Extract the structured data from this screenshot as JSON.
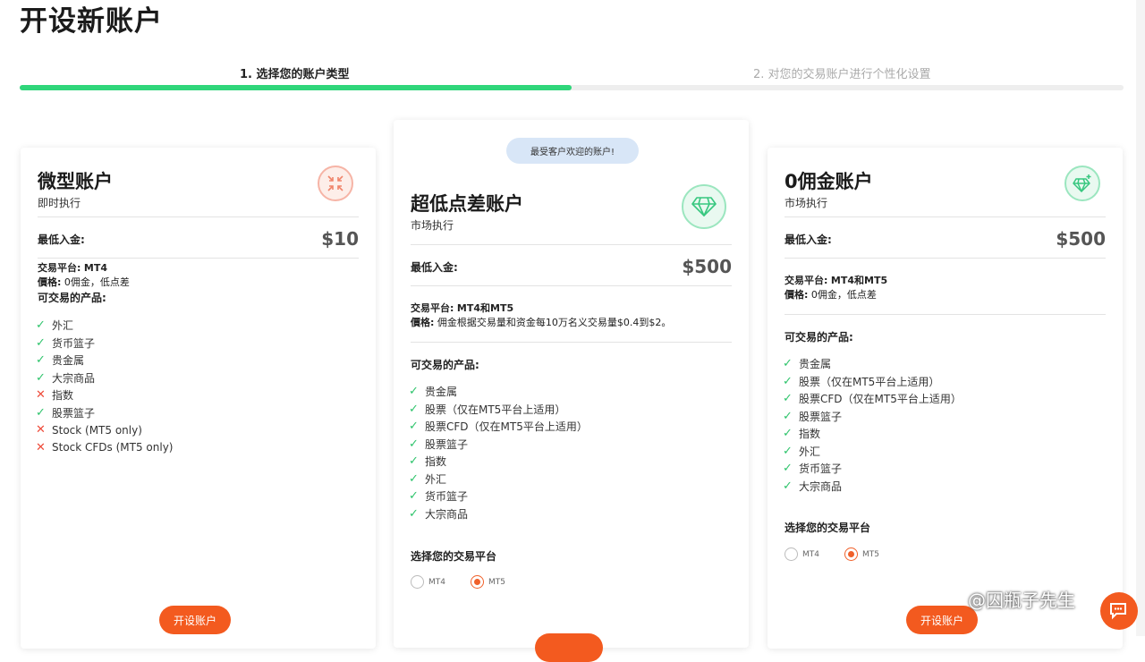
{
  "page": {
    "title": "开设新账户"
  },
  "steps": {
    "step1": "1. 选择您的账户类型",
    "step2": "2. 对您的交易账户进行个性化设置",
    "progress_fraction": 0.5
  },
  "colors": {
    "accent": "#f35a1f",
    "progress": "#2fd67a",
    "check": "#2fc46c",
    "cross": "#ee4b3a",
    "badge_bg": "#d8e6f7"
  },
  "cards": [
    {
      "title": "微型账户",
      "subtitle": "即时执行",
      "icon": "compress-arrows-icon",
      "deposit_label": "最低入金:",
      "deposit_value": "$10",
      "platform_label": "交易平台:",
      "platform_value": "MT4",
      "price_label": "價格:",
      "price_value": "0佣金，低点差",
      "products_label": "可交易的产品:",
      "products": [
        {
          "name": "外汇",
          "available": true
        },
        {
          "name": "货币篮子",
          "available": true
        },
        {
          "name": "贵金属",
          "available": true
        },
        {
          "name": "大宗商品",
          "available": true
        },
        {
          "name": "指数",
          "available": false
        },
        {
          "name": "股票篮子",
          "available": true
        },
        {
          "name": "Stock (MT5 only)",
          "available": false
        },
        {
          "name": "Stock CFDs (MT5 only)",
          "available": false
        }
      ],
      "open_button": "开设账户"
    },
    {
      "badge": "最受客户欢迎的账户!",
      "title": "超低点差账户",
      "subtitle": "市场执行",
      "icon": "diamond-icon",
      "deposit_label": "最低入金:",
      "deposit_value": "$500",
      "platform_label": "交易平台:",
      "platform_value": "MT4和MT5",
      "price_label": "價格:",
      "price_value": "佣金根据交易量和资金每10万名义交易量$0.4到$2。",
      "products_label": "可交易的产品:",
      "products": [
        {
          "name": "贵金属",
          "available": true
        },
        {
          "name": "股票（仅在MT5平台上适用）",
          "available": true
        },
        {
          "name": "股票CFD（仅在MT5平台上适用）",
          "available": true
        },
        {
          "name": "股票篮子",
          "available": true
        },
        {
          "name": "指数",
          "available": true
        },
        {
          "name": "外汇",
          "available": true
        },
        {
          "name": "货币篮子",
          "available": true
        },
        {
          "name": "大宗商品",
          "available": true
        }
      ],
      "platform_select_label": "选择您的交易平台",
      "platform_options": [
        "MT4",
        "MT5"
      ],
      "platform_selected": "MT5"
    },
    {
      "title": "0佣金账户",
      "subtitle": "市场执行",
      "icon": "diamond-plus-icon",
      "deposit_label": "最低入金:",
      "deposit_value": "$500",
      "platform_label": "交易平台:",
      "platform_value": "MT4和MT5",
      "price_label": "價格:",
      "price_value": "0佣金，低点差",
      "products_label": "可交易的产品:",
      "products": [
        {
          "name": "贵金属",
          "available": true
        },
        {
          "name": "股票（仅在MT5平台上适用）",
          "available": true
        },
        {
          "name": "股票CFD（仅在MT5平台上适用）",
          "available": true
        },
        {
          "name": "股票篮子",
          "available": true
        },
        {
          "name": "指数",
          "available": true
        },
        {
          "name": "外汇",
          "available": true
        },
        {
          "name": "货币篮子",
          "available": true
        },
        {
          "name": "大宗商品",
          "available": true
        }
      ],
      "platform_select_label": "选择您的交易平台",
      "platform_options": [
        "MT4",
        "MT5"
      ],
      "platform_selected": "MT5",
      "open_button": "开设账户"
    }
  ],
  "watermark": "@囚瓶子先生",
  "chat_icon": "chat-bubble-icon"
}
